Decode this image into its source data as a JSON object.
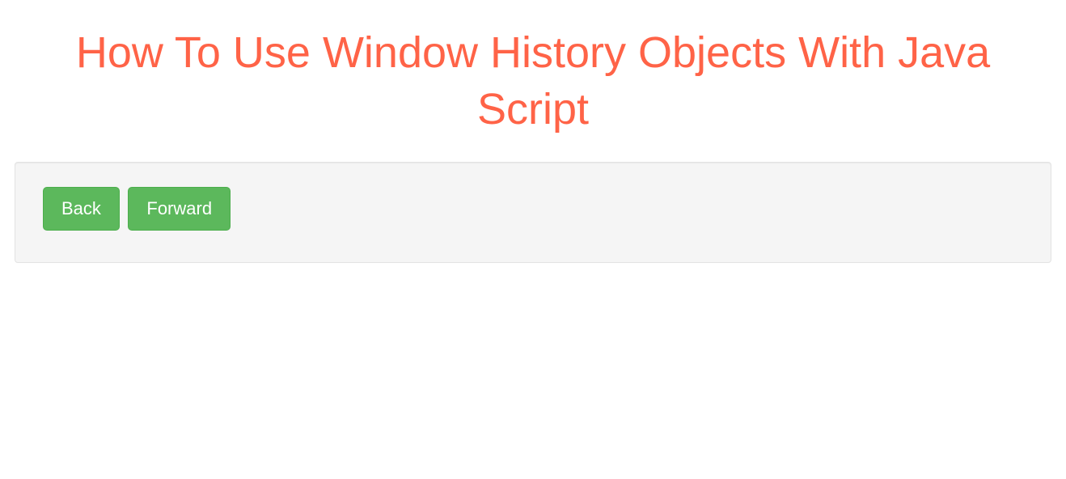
{
  "header": {
    "title": "How To Use Window History Objects With Java Script"
  },
  "panel": {
    "buttons": {
      "back_label": "Back",
      "forward_label": "Forward"
    }
  },
  "colors": {
    "title_color": "#ff6347",
    "button_bg": "#5cb85c",
    "well_bg": "#f5f5f5"
  }
}
